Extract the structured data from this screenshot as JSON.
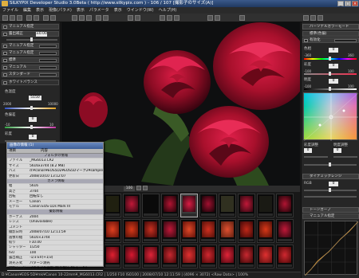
{
  "window": {
    "title": "SILKYPIX Developer Studio 3.0Beta ( http://www.silkypix.com ) - 106 / 107 [撮影子のサイズ(A)]",
    "minimize": "_",
    "maximize": "□",
    "close": "×"
  },
  "menu": [
    "ファイル",
    "編集",
    "表示",
    "現像(パラメ)",
    "表示",
    "パラメータ",
    "表示",
    "ウインドウ(W)",
    "ヘルプ(H)"
  ],
  "left_panel": {
    "rows": [
      {
        "label": "マニュアル指定"
      },
      {
        "label": "露出補正"
      },
      {
        "label": "マニュアル指定"
      },
      {
        "label": "マニュアル指定"
      },
      {
        "label": "標準"
      },
      {
        "label": "マニュアル"
      },
      {
        "label": "スタンダード"
      }
    ],
    "exposure_value": "±0.00",
    "wb_section": "ホワイトバランス",
    "color_temp_label": "色温度",
    "color_temp_value": "5150",
    "color_temp_min": "2000",
    "color_temp_max": "10000",
    "color_dev_label": "色偏差",
    "color_dev_value": "0",
    "color_dev_min": "-10",
    "color_dev_max": "10",
    "sat_label": "彩度",
    "sat_value": "0"
  },
  "info_panel": {
    "title": "画像の情報 (1)",
    "col_key": "項目",
    "col_val": "内容",
    "rows": [
      {
        "k": "",
        "v": "フォルダの情報",
        "section": true
      },
      {
        "k": "ファイル",
        "v": "_MG6013.CR2"
      },
      {
        "k": "サイズ",
        "v": "5616x3744 (8.2 MB)"
      },
      {
        "k": "パス",
        "v": "d:¥canon¥EOS5D2¥EOS5Dマーク2¥sample"
      },
      {
        "k": "更新日",
        "v": "2008/10/10 13:12:07"
      },
      {
        "k": "",
        "v": "カメラ情報",
        "section": true
      },
      {
        "k": "幅",
        "v": "5616"
      },
      {
        "k": "高さ",
        "v": "3744"
      },
      {
        "k": "回転",
        "v": "回転なし"
      },
      {
        "k": "メーカー",
        "v": "Canon"
      },
      {
        "k": "モデル",
        "v": "Canon EOS-1Ds Mark III"
      },
      {
        "k": "",
        "v": "撮影情報",
        "section": true
      },
      {
        "k": "ボーナス",
        "v": "2004"
      },
      {
        "k": "レンズ",
        "v": "(Unavailable)"
      },
      {
        "k": "コメント",
        "v": ""
      },
      {
        "k": "撮影日時",
        "v": "2008/07/10 12:11:59"
      },
      {
        "k": "画像の幅",
        "v": "5616×3744"
      },
      {
        "k": "絞り",
        "v": "F10.00"
      },
      {
        "k": "シャッター",
        "v": "1/250"
      },
      {
        "k": "ISO",
        "v": "100"
      },
      {
        "k": "露出補正",
        "v": "-1/3 EV(+1/3)"
      },
      {
        "k": "測光方式",
        "v": "パターン測光"
      },
      {
        "k": "撮影モード",
        "v": "マニュアル露出 (絞り優先 AEモード)"
      },
      {
        "k": "ホワイト",
        "v": "オート"
      },
      {
        "k": "焦点距離",
        "v": "100 mm (100 mm)"
      }
    ]
  },
  "right_panel": {
    "head1": "パーソナルカラーモード",
    "sel1": "標準(色偏)",
    "chk1": "有効化",
    "value1": "標準",
    "hue_label": "色相",
    "hue_value": "0",
    "hue_min": "-360",
    "hue_max": "360",
    "sat_label": "彩度",
    "sat_value": "0",
    "sat_min": "-100",
    "sat_max": "100",
    "light_label": "明度",
    "light_value": "0",
    "light_min": "-100",
    "light_max": "100",
    "range_label1": "彩度調整",
    "range_label2": "明度調整",
    "val_a": "0",
    "val_b": "0",
    "sharp_head": "ダイナミックレンジ",
    "sharp_label1": "RGB",
    "sharp_value1": "0",
    "tone_head": "トーンカーブ",
    "tone_sel": "マニュアル指定"
  },
  "viewer_bar": "100",
  "status": "D:¥Canon¥EOS-5D¥mk¥Canon 10-22mm¥_MG6013.CR2 | 1/250 F10 ISO100 | 2008/07/10 12:11:59 | (4096 × 3072) <Raw Data> | 100%",
  "colors": {
    "rose_dark": "#5a0818",
    "rose_mid": "#a8102c",
    "rose_light": "#e0204a",
    "leaf": "#2d4a1e",
    "bg": "#0e0f10"
  }
}
